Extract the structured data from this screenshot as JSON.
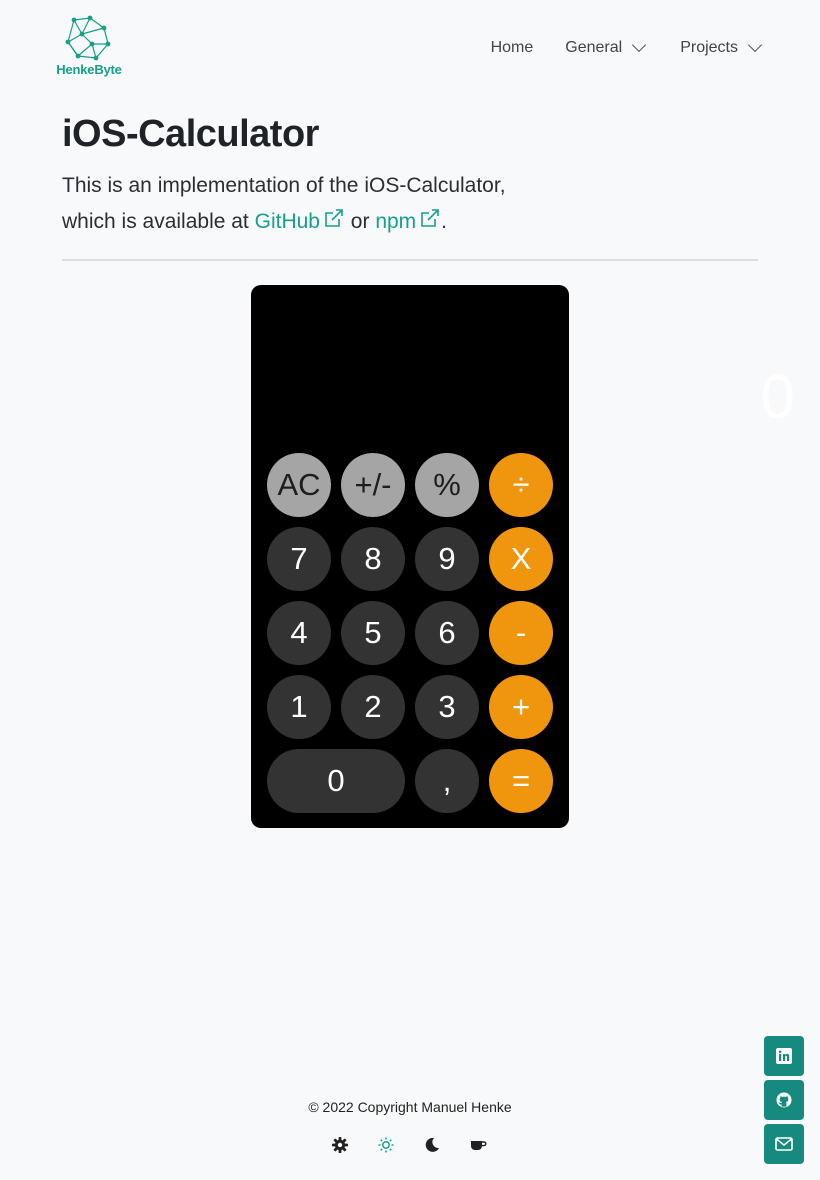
{
  "header": {
    "logo_text": "HenkeByte",
    "nav": [
      {
        "label": "Home"
      },
      {
        "label": "General"
      },
      {
        "label": "Projects"
      }
    ]
  },
  "intro": {
    "title": "iOS-Calculator",
    "line1": "This is an implementation of the iOS-Calculator,",
    "line2_prefix": "which is available at ",
    "link_github": "GitHub",
    "or": " or ",
    "link_npm": "npm",
    "suffix": "."
  },
  "calculator": {
    "display": "0",
    "rows": [
      [
        {
          "label": "AC",
          "kind": "fn"
        },
        {
          "label": "+/-",
          "kind": "fn"
        },
        {
          "label": "%",
          "kind": "fn"
        },
        {
          "label": "÷",
          "kind": "op"
        }
      ],
      [
        {
          "label": "7",
          "kind": "num"
        },
        {
          "label": "8",
          "kind": "num"
        },
        {
          "label": "9",
          "kind": "num"
        },
        {
          "label": "X",
          "kind": "op"
        }
      ],
      [
        {
          "label": "4",
          "kind": "num"
        },
        {
          "label": "5",
          "kind": "num"
        },
        {
          "label": "6",
          "kind": "num"
        },
        {
          "label": "-",
          "kind": "op"
        }
      ],
      [
        {
          "label": "1",
          "kind": "num"
        },
        {
          "label": "2",
          "kind": "num"
        },
        {
          "label": "3",
          "kind": "num"
        },
        {
          "label": "+",
          "kind": "op"
        }
      ],
      [
        {
          "label": "0",
          "kind": "num"
        },
        {
          "label": ",",
          "kind": "num"
        },
        {
          "label": "=",
          "kind": "op"
        }
      ]
    ]
  },
  "footer": {
    "copyright": "© 2022 Copyright Manuel Henke",
    "themes": [
      "gear-icon",
      "sun-icon",
      "moon-icon",
      "coffee-icon"
    ]
  },
  "social": [
    "linkedin-icon",
    "github-icon",
    "mail-icon"
  ],
  "colors": {
    "accent": "#17a08a",
    "operator": "#f0960e",
    "function": "#a5a5a5",
    "number": "#333333"
  }
}
